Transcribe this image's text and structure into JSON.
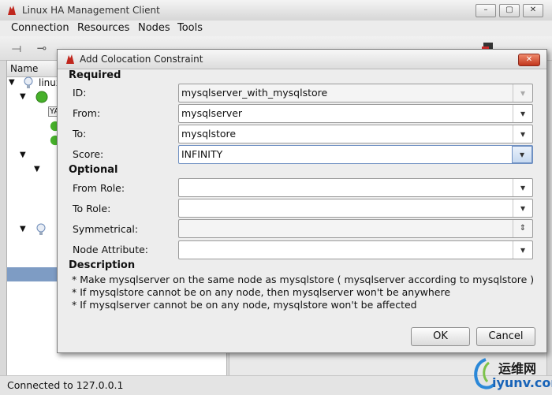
{
  "window": {
    "title": "Linux HA Management Client",
    "min": "–",
    "max": "▢",
    "close": "✕"
  },
  "menu": [
    "Connection",
    "Resources",
    "Nodes",
    "Tools"
  ],
  "left_pane": {
    "header": "Name",
    "root_label": "linux"
  },
  "status": "Connected to 127.0.0.1",
  "dialog": {
    "title": "Add Colocation Constraint",
    "close": "✕",
    "required": "Required",
    "optional": "Optional",
    "fields": {
      "id": {
        "label": "ID:",
        "value": "mysqlserver_with_mysqlstore"
      },
      "from": {
        "label": "From:",
        "value": "mysqlserver"
      },
      "to": {
        "label": "To:",
        "value": "mysqlstore"
      },
      "score": {
        "label": "Score:",
        "value": "INFINITY"
      },
      "from_role": {
        "label": "From Role:",
        "value": ""
      },
      "to_role": {
        "label": "To Role:",
        "value": ""
      },
      "symmetrical": {
        "label": "Symmetrical:",
        "value": ""
      },
      "node_attribute": {
        "label": "Node Attribute:",
        "value": ""
      }
    },
    "description_title": "Description",
    "description": [
      "* Make mysqlserver  on the same node as mysqlstore   ( mysqlserver according to mysqlstore )",
      "* If mysqlstore cannot be  on any node, then mysqlserver won't be  anywhere",
      "* If mysqlserver cannot be  on any node, mysqlstore won't be affected"
    ],
    "ok": "OK",
    "cancel": "Cancel"
  },
  "watermark": {
    "chinese": "运维网",
    "url": "iyunv.com"
  }
}
